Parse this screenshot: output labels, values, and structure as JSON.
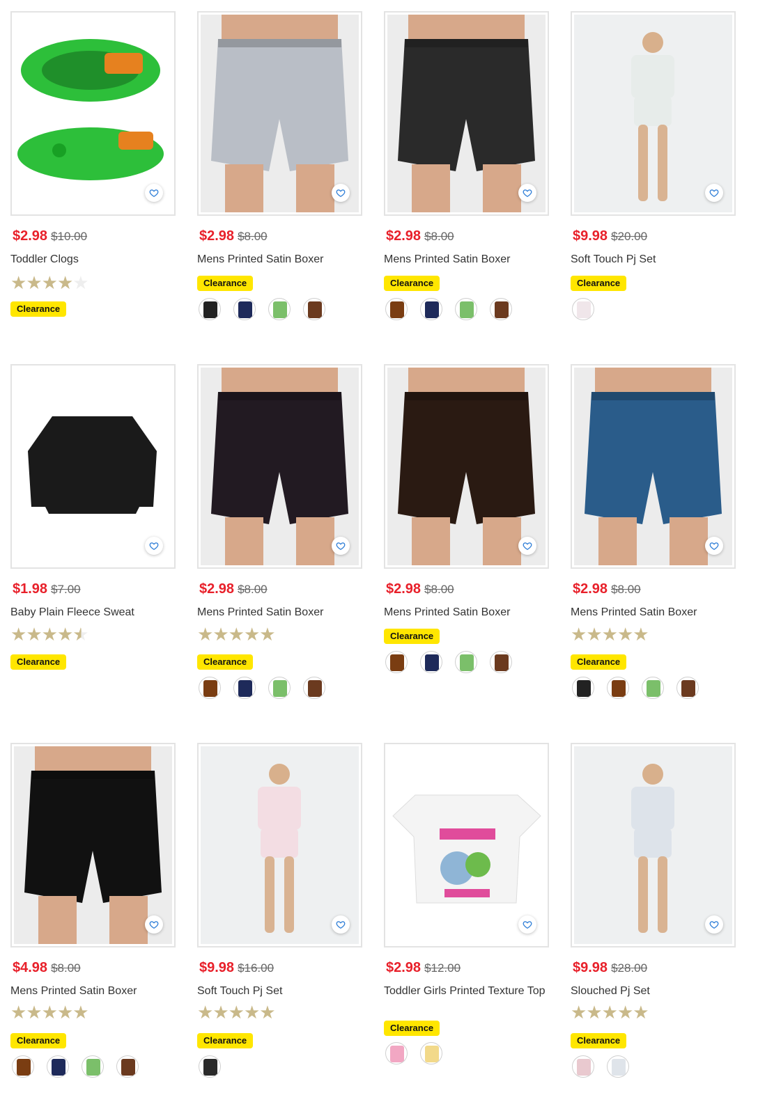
{
  "products": [
    {
      "title": "Toddler Clogs",
      "price": "$2.98",
      "was": "$10.00",
      "rating": 4,
      "badge": "Clearance",
      "swatches": [],
      "bg": "#2dbf3a",
      "image": "green-clogs"
    },
    {
      "title": "Mens Printed Satin Boxer",
      "price": "$2.98",
      "was": "$8.00",
      "rating": 0,
      "badge": "Clearance",
      "swatches": [
        "#222222",
        "#1e2a5a",
        "#7bbf6a",
        "#6b3a1f"
      ],
      "bg": "#b9bec6",
      "image": "grey-fox-boxer"
    },
    {
      "title": "Mens Printed Satin Boxer",
      "price": "$2.98",
      "was": "$8.00",
      "rating": 0,
      "badge": "Clearance",
      "swatches": [
        "#7a3d12",
        "#1e2a5a",
        "#7bbf6a",
        "#6b3a1f"
      ],
      "bg": "#2a2a2a",
      "image": "skull-boxer"
    },
    {
      "title": "Soft Touch Pj Set",
      "price": "$9.98",
      "was": "$20.00",
      "rating": 0,
      "badge": "Clearance",
      "swatches": [
        "#f0e6ea"
      ],
      "bg": "#e7ecea",
      "image": "mint-pj-set"
    },
    {
      "title": "Baby Plain Fleece Sweat",
      "price": "$1.98",
      "was": "$7.00",
      "rating": 4.5,
      "badge": "Clearance",
      "swatches": [],
      "bg": "#1a1a1a",
      "image": "black-sweat"
    },
    {
      "title": "Mens Printed Satin Boxer",
      "price": "$2.98",
      "was": "$8.00",
      "rating": 5,
      "badge": "Clearance",
      "swatches": [
        "#7a3d12",
        "#1e2a5a",
        "#7bbf6a",
        "#6b3a1f"
      ],
      "bg": "#221a22",
      "image": "eggplant-boxer"
    },
    {
      "title": "Mens Printed Satin Boxer",
      "price": "$2.98",
      "was": "$8.00",
      "rating": 0,
      "badge": "Clearance",
      "swatches": [
        "#7a3d12",
        "#1e2a5a",
        "#7bbf6a",
        "#6b3a1f"
      ],
      "bg": "#2a1a12",
      "image": "chilli-boxer"
    },
    {
      "title": "Mens Printed Satin Boxer",
      "price": "$2.98",
      "was": "$8.00",
      "rating": 5,
      "badge": "Clearance",
      "swatches": [
        "#222222",
        "#7a3d12",
        "#7bbf6a",
        "#6b3a1f"
      ],
      "bg": "#2a5c8a",
      "image": "blue-hearts-boxer"
    },
    {
      "title": "Mens Printed Satin Boxer",
      "price": "$4.98",
      "was": "$8.00",
      "rating": 5,
      "badge": "Clearance",
      "swatches": [
        "#7a3d12",
        "#1e2a5a",
        "#7bbf6a",
        "#6b3a1f"
      ],
      "bg": "#111111",
      "image": "black-stripe-boxer"
    },
    {
      "title": "Soft Touch Pj Set",
      "price": "$9.98",
      "was": "$16.00",
      "rating": 5,
      "badge": "Clearance",
      "swatches": [
        "#2a2a2a"
      ],
      "bg": "#f3dde3",
      "image": "pink-heart-pj"
    },
    {
      "title": "Toddler Girls Printed Texture Top",
      "price": "$2.98",
      "was": "$12.00",
      "rating": 0,
      "badge": "Clearance",
      "swatches": [
        "#f2a7c3",
        "#f2d98a"
      ],
      "bg": "#f2f2f2",
      "image": "tropical-waves-top"
    },
    {
      "title": "Slouched Pj Set",
      "price": "$9.98",
      "was": "$28.00",
      "rating": 5,
      "badge": "Clearance",
      "swatches": [
        "#e9c9cf",
        "#dfe4ea"
      ],
      "bg": "#dde3ea",
      "image": "stripe-pj-set"
    }
  ],
  "icons": {
    "wishlist": "heart-outline-icon",
    "star": "star-icon"
  },
  "colors": {
    "price": "#e8202a",
    "badge": "#ffe600",
    "star": "#c9b98a",
    "wish": "#2a7bd6"
  }
}
